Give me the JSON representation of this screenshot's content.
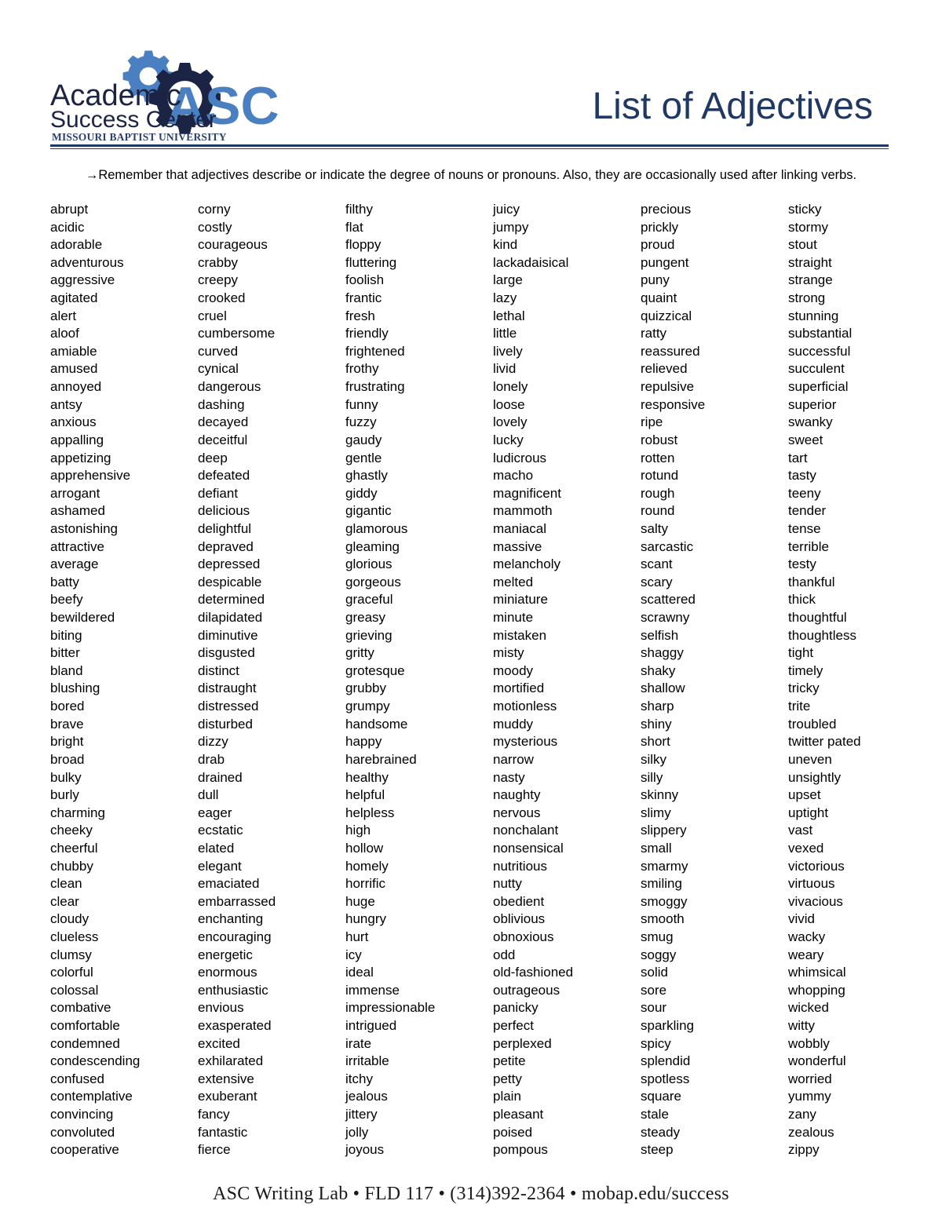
{
  "header": {
    "logo": {
      "line1": "Academic",
      "line2": "Success Center",
      "line3": "MISSOURI BAPTIST UNIVERSITY",
      "monogram": "ASC",
      "colors": {
        "navy": "#1b2444",
        "blue": "#4a7fc1",
        "rule": "#1f3864"
      }
    },
    "title": "List of Adjectives"
  },
  "subtitle": "→Remember that adjectives describe or indicate the degree of nouns or pronouns.  Also, they are occasionally used after linking verbs.",
  "columns": [
    {
      "index": 1,
      "words": [
        "abrupt",
        "acidic",
        "adorable",
        "adventurous",
        "aggressive",
        "agitated",
        "alert",
        "aloof",
        "amiable",
        "amused",
        "annoyed",
        "antsy",
        "anxious",
        "appalling",
        "appetizing",
        "apprehensive",
        "arrogant",
        "ashamed",
        "astonishing",
        "attractive",
        "average",
        "batty",
        "beefy",
        "bewildered",
        "biting",
        "bitter",
        "bland",
        "blushing",
        "bored",
        "brave",
        "bright",
        "broad",
        "bulky",
        "burly",
        "charming",
        "cheeky",
        "cheerful",
        "chubby",
        "clean",
        "clear",
        "cloudy",
        "clueless",
        "clumsy",
        "colorful",
        "colossal",
        "combative",
        "comfortable",
        "condemned",
        "condescending",
        "confused",
        "contemplative",
        "convincing",
        "convoluted",
        "cooperative"
      ]
    },
    {
      "index": 2,
      "words": [
        "corny",
        "costly",
        "courageous",
        "crabby",
        "creepy",
        "crooked",
        "cruel",
        "cumbersome",
        "curved",
        "cynical",
        "dangerous",
        "dashing",
        "decayed",
        "deceitful",
        "deep",
        "defeated",
        "defiant",
        "delicious",
        "delightful",
        "depraved",
        "depressed",
        "despicable",
        "determined",
        "dilapidated",
        "diminutive",
        "disgusted",
        "distinct",
        "distraught",
        "distressed",
        "disturbed",
        "dizzy",
        "drab",
        "drained",
        "dull",
        "eager",
        "ecstatic",
        "elated",
        "elegant",
        "emaciated",
        "embarrassed",
        "enchanting",
        "encouraging",
        "energetic",
        "enormous",
        "enthusiastic",
        "envious",
        "exasperated",
        "excited",
        "exhilarated",
        "extensive",
        "exuberant",
        "fancy",
        "fantastic",
        "fierce"
      ]
    },
    {
      "index": 3,
      "words": [
        "filthy",
        "flat",
        "floppy",
        "fluttering",
        "foolish",
        "frantic",
        "fresh",
        "friendly",
        "frightened",
        "frothy",
        "frustrating",
        "funny",
        "fuzzy",
        "gaudy",
        "gentle",
        "ghastly",
        "giddy",
        "gigantic",
        "glamorous",
        "gleaming",
        "glorious",
        "gorgeous",
        "graceful",
        "greasy",
        "grieving",
        "gritty",
        "grotesque",
        "grubby",
        "grumpy",
        "handsome",
        "happy",
        "harebrained",
        "healthy",
        "helpful",
        "helpless",
        "high",
        "hollow",
        "homely",
        "horrific",
        "huge",
        "hungry",
        "hurt",
        "icy",
        "ideal",
        "immense",
        "impressionable",
        "intrigued",
        "irate",
        "irritable",
        "itchy",
        "jealous",
        "jittery",
        "jolly",
        "joyous"
      ]
    },
    {
      "index": 4,
      "words": [
        "juicy",
        "jumpy",
        "kind",
        "lackadaisical",
        "large",
        "lazy",
        "lethal",
        "little",
        "lively",
        "livid",
        "lonely",
        "loose",
        "lovely",
        "lucky",
        "ludicrous",
        "macho",
        "magnificent",
        "mammoth",
        "maniacal",
        "massive",
        "melancholy",
        "melted",
        "miniature",
        "minute",
        "mistaken",
        "misty",
        "moody",
        "mortified",
        "motionless",
        "muddy",
        "mysterious",
        "narrow",
        "nasty",
        "naughty",
        "nervous",
        "nonchalant",
        "nonsensical",
        "nutritious",
        "nutty",
        "obedient",
        "oblivious",
        "obnoxious",
        "odd",
        "old-fashioned",
        "outrageous",
        "panicky",
        "perfect",
        "perplexed",
        "petite",
        "petty",
        "plain",
        "pleasant",
        "poised",
        "pompous"
      ]
    },
    {
      "index": 5,
      "words": [
        "precious",
        "prickly",
        "proud",
        "pungent",
        "puny",
        "quaint",
        "quizzical",
        "ratty",
        "reassured",
        "relieved",
        "repulsive",
        "responsive",
        "ripe",
        "robust",
        "rotten",
        "rotund",
        "rough",
        "round",
        "salty",
        "sarcastic",
        "scant",
        "scary",
        "scattered",
        "scrawny",
        "selfish",
        "shaggy",
        "shaky",
        "shallow",
        "sharp",
        "shiny",
        "short",
        "silky",
        "silly",
        "skinny",
        "slimy",
        "slippery",
        "small",
        "smarmy",
        "smiling",
        "smoggy",
        "smooth",
        "smug",
        "soggy",
        "solid",
        "sore",
        "sour",
        "sparkling",
        "spicy",
        "splendid",
        "spotless",
        "square",
        "stale",
        "steady",
        "steep"
      ]
    },
    {
      "index": 6,
      "words": [
        "sticky",
        "stormy",
        "stout",
        "straight",
        "strange",
        "strong",
        "stunning",
        "substantial",
        "successful",
        "succulent",
        "superficial",
        "superior",
        "swanky",
        "sweet",
        "tart",
        "tasty",
        "teeny",
        "tender",
        "tense",
        "terrible",
        "testy",
        "thankful",
        "thick",
        "thoughtful",
        "thoughtless",
        "tight",
        "timely",
        "tricky",
        "trite",
        "troubled",
        "twitter pated",
        "uneven",
        "unsightly",
        "upset",
        "uptight",
        "vast",
        "vexed",
        "victorious",
        "virtuous",
        "vivacious",
        "vivid",
        "wacky",
        "weary",
        "whimsical",
        "whopping",
        "wicked",
        "witty",
        "wobbly",
        "wonderful",
        "worried",
        "yummy",
        "zany",
        "zealous",
        "zippy"
      ]
    }
  ],
  "footer": "ASC Writing Lab • FLD 117 • (314)392-2364 • mobap.edu/success"
}
